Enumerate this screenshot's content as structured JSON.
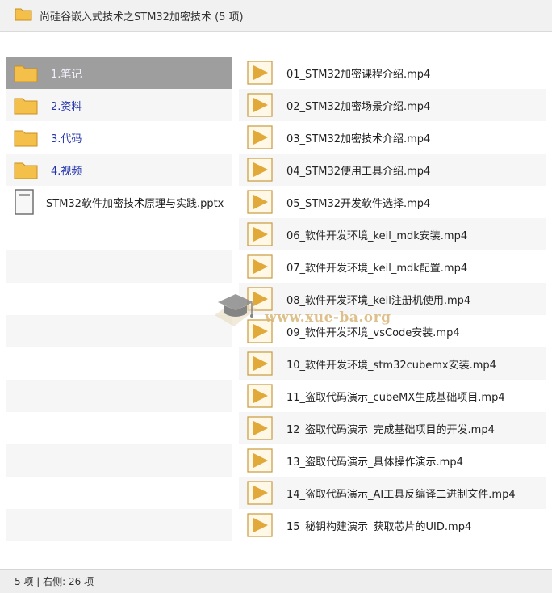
{
  "window": {
    "title": "尚硅谷嵌入式技术之STM32加密技术 (5 项)"
  },
  "left_pane": {
    "items": [
      {
        "label": "1.笔记",
        "kind": "folder",
        "icon": "folder-icon",
        "selected": true
      },
      {
        "label": "2.资料",
        "kind": "folder",
        "icon": "folder-icon"
      },
      {
        "label": "3.代码",
        "kind": "folder",
        "icon": "folder-icon"
      },
      {
        "label": "4.视频",
        "kind": "folder",
        "icon": "folder-icon"
      },
      {
        "label": "STM32软件加密技术原理与实践.pptx",
        "kind": "file",
        "icon": "document-icon"
      }
    ]
  },
  "right_pane": {
    "items": [
      {
        "label": "01_STM32加密课程介绍.mp4"
      },
      {
        "label": "02_STM32加密场景介绍.mp4"
      },
      {
        "label": "03_STM32加密技术介绍.mp4"
      },
      {
        "label": "04_STM32使用工具介绍.mp4"
      },
      {
        "label": "05_STM32开发软件选择.mp4"
      },
      {
        "label": "06_软件开发环境_keil_mdk安装.mp4"
      },
      {
        "label": "07_软件开发环境_keil_mdk配置.mp4"
      },
      {
        "label": "08_软件开发环境_keil注册机使用.mp4"
      },
      {
        "label": "09_软件开发环境_vsCode安装.mp4"
      },
      {
        "label": "10_软件开发环境_stm32cubemx安装.mp4"
      },
      {
        "label": "11_盗取代码演示_cubeMX生成基础项目.mp4"
      },
      {
        "label": "12_盗取代码演示_完成基础项目的开发.mp4"
      },
      {
        "label": "13_盗取代码演示_具体操作演示.mp4"
      },
      {
        "label": "14_盗取代码演示_AI工具反编译二进制文件.mp4"
      },
      {
        "label": "15_秘钥构建演示_获取芯片的UID.mp4"
      }
    ]
  },
  "status_bar": {
    "text": "5 项 | 右侧: 26 项"
  },
  "watermark": {
    "text": "www.xue-ba.org"
  },
  "colors": {
    "folder": "#f5c04a",
    "video_icon": "#e0a93a",
    "selection": "#9e9e9e",
    "folder_label": "#2233aa"
  }
}
